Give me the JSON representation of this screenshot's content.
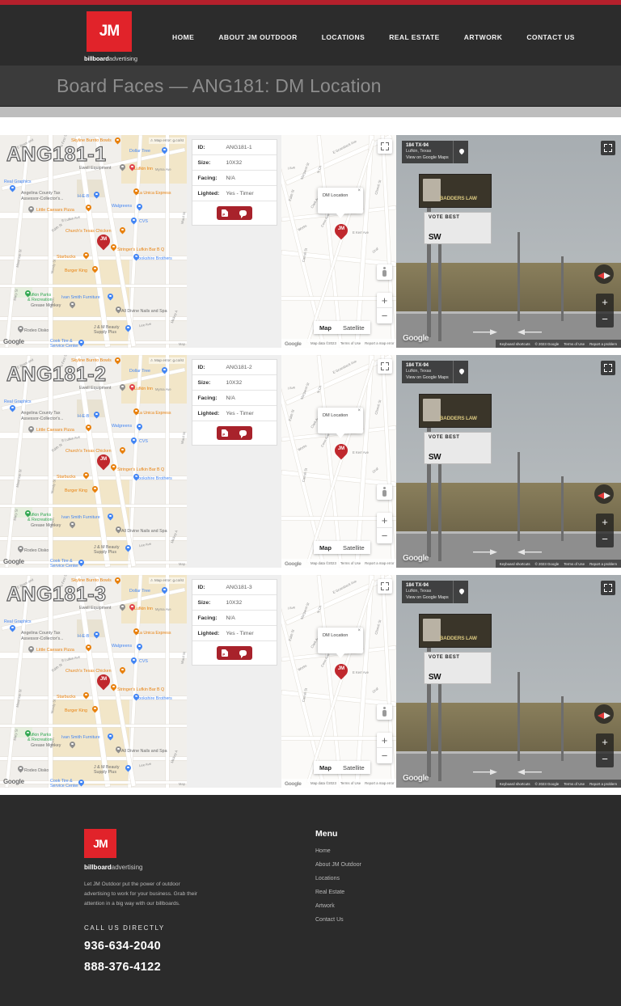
{
  "header": {
    "brand": {
      "mark": "JM",
      "tagline_bold": "billboard",
      "tagline_light": "advertising"
    },
    "nav": [
      {
        "label": "HOME"
      },
      {
        "label": "ABOUT JM OUTDOOR"
      },
      {
        "label": "LOCATIONS"
      },
      {
        "label": "REAL ESTATE"
      },
      {
        "label": "ARTWORK"
      },
      {
        "label": "CONTACT US"
      }
    ],
    "accent_color": "#b5202c",
    "background_color": "#2c2c2c"
  },
  "page_title": "Board Faces — ANG181: DM Location",
  "rows": [
    {
      "face_label": "ANG181-1",
      "static_map": {
        "map_error": "Map error: g.co/st",
        "attribution": "Google",
        "corner": "Map",
        "pois": [
          "Skyline Burrito Bowls",
          "Dollar Tree",
          "Ewell Equipment",
          "Lufkin Inn",
          "Real Graphics",
          "Angelina County Tax Assessor-Collector's...",
          "H-E-B",
          "La Unica Express",
          "Little Caesars Pizza",
          "Walgreens",
          "CVS",
          "Church's Texas Chicken",
          "Starbucks",
          "Stringer's Lufkin Bar B Q",
          "Brookshire Brothers",
          "Burger King",
          "Lufkin Parks & Recreation",
          "Ivan Smith Furniture",
          "Grease Monkey",
          "All Divine Nails and Spa",
          "Rodeo Disko",
          "J & M Beauty Supply Plus",
          "Cook Tire & Service Center"
        ],
        "streets": [
          "E Brem ond",
          "N First St",
          "Myrna Ave",
          "E Lufkin Ave",
          "Edith St",
          "Moody St",
          "Montrose St",
          "Lee Ave",
          "Mickey A",
          "Ward St"
        ]
      },
      "details": {
        "rows": [
          {
            "key": "ID:",
            "value": "ANG181-1"
          },
          {
            "key": "Size:",
            "value": "10X32"
          },
          {
            "key": "Facing:",
            "value": "N/A"
          },
          {
            "key": "Lighted:",
            "value": "Yes - Timer"
          }
        ],
        "buttons": [
          {
            "icon": "pdf-icon"
          },
          {
            "icon": "chat-icon"
          }
        ]
      },
      "interactive_map": {
        "infowindow_title": "DM Location",
        "close_label": "×",
        "map_type_options": [
          "Map",
          "Satellite"
        ],
        "map_type_selected": "Map",
        "zoom_in": "+",
        "zoom_out": "−",
        "attribution": "Google",
        "footer_links": [
          "Map data ©2023",
          "Terms of Use",
          "Report a map error"
        ],
        "streets": [
          "E Groesbeck Ave",
          "Margaret St",
          "N Ch",
          "Edith St",
          "Clark Ave",
          "Conn Ave",
          "Church St",
          "Carroll St",
          "E Kerr Ave",
          "Gra"
        ]
      },
      "street_view": {
        "address_line1": "184 TX-94",
        "address_line2": "Lufkin, Texas",
        "link_text": "View on Google Maps",
        "attribution": "Google",
        "billboard_top_text": "BADDERS LAW",
        "billboard_bottom_text1": "VOTE BEST",
        "billboard_bottom_text2": "SW",
        "footer_links": [
          "Keyboard shortcuts",
          "© 2023 Google",
          "Terms of Use",
          "Report a problem"
        ],
        "zoom_in": "+",
        "zoom_out": "−"
      }
    },
    {
      "face_label": "ANG181-2",
      "static_map": {
        "map_error": "Map error: g.co/st",
        "attribution": "Google",
        "corner": "Map",
        "pois": [
          "Skyline Burrito Bowls",
          "Dollar Tree",
          "Ewell Equipment",
          "Lufkin Inn",
          "Real Graphics",
          "Angelina County Tax Assessor-Collector's...",
          "H-E-B",
          "La Unica Express",
          "Little Caesars Pizza",
          "Walgreens",
          "CVS",
          "Church's Texas Chicken",
          "Starbucks",
          "Stringer's Lufkin Bar B Q",
          "Brookshire Brothers",
          "Burger King",
          "Lufkin Parks & Recreation",
          "Ivan Smith Furniture",
          "Grease Monkey",
          "All Divine Nails and Spa",
          "Rodeo Disko",
          "J & M Beauty Supply Plus",
          "Cook Tire & Service Center"
        ],
        "streets": [
          "E Brem ond",
          "N First St",
          "Myrna Ave",
          "E Lufkin Ave",
          "Edith St",
          "Moody St",
          "Montrose St",
          "Lee Ave",
          "Mickey A",
          "Ward St"
        ]
      },
      "details": {
        "rows": [
          {
            "key": "ID:",
            "value": "ANG181-2"
          },
          {
            "key": "Size:",
            "value": "10X32"
          },
          {
            "key": "Facing:",
            "value": "N/A"
          },
          {
            "key": "Lighted:",
            "value": "Yes - Timer"
          }
        ],
        "buttons": [
          {
            "icon": "pdf-icon"
          },
          {
            "icon": "chat-icon"
          }
        ]
      },
      "interactive_map": {
        "infowindow_title": "DM Location",
        "close_label": "×",
        "map_type_options": [
          "Map",
          "Satellite"
        ],
        "map_type_selected": "Map",
        "zoom_in": "+",
        "zoom_out": "−",
        "attribution": "Google",
        "footer_links": [
          "Map data ©2023",
          "Terms of Use",
          "Report a map error"
        ],
        "streets": [
          "E Groesbeck Ave",
          "Margaret St",
          "N Ch",
          "Edith St",
          "Clark Ave",
          "Conn Ave",
          "Church St",
          "Carroll St",
          "E Kerr Ave",
          "Gra"
        ]
      },
      "street_view": {
        "address_line1": "184 TX-94",
        "address_line2": "Lufkin, Texas",
        "link_text": "View on Google Maps",
        "attribution": "Google",
        "billboard_top_text": "BADDERS LAW",
        "billboard_bottom_text1": "VOTE BEST",
        "billboard_bottom_text2": "SW",
        "footer_links": [
          "Keyboard shortcuts",
          "© 2023 Google",
          "Terms of Use",
          "Report a problem"
        ],
        "zoom_in": "+",
        "zoom_out": "−"
      }
    },
    {
      "face_label": "ANG181-3",
      "static_map": {
        "map_error": "Map error: g.co/st",
        "attribution": "Google",
        "corner": "Map",
        "pois": [
          "Skyline Burrito Bowls",
          "Dollar Tree",
          "Ewell Equipment",
          "Lufkin Inn",
          "Real Graphics",
          "Angelina County Tax Assessor-Collector's...",
          "H-E-B",
          "La Unica Express",
          "Little Caesars Pizza",
          "Walgreens",
          "CVS",
          "Church's Texas Chicken",
          "Starbucks",
          "Stringer's Lufkin Bar B Q",
          "Brookshire Brothers",
          "Burger King",
          "Lufkin Parks & Recreation",
          "Ivan Smith Furniture",
          "Grease Monkey",
          "All Divine Nails and Spa",
          "Rodeo Disko",
          "J & M Beauty Supply Plus",
          "Cook Tire & Service Center"
        ],
        "streets": [
          "E Brem ond",
          "N First St",
          "Myrna Ave",
          "E Lufkin Ave",
          "Edith St",
          "Moody St",
          "Montrose St",
          "Lee Ave",
          "Mickey A",
          "Ward St"
        ]
      },
      "details": {
        "rows": [
          {
            "key": "ID:",
            "value": "ANG181-3"
          },
          {
            "key": "Size:",
            "value": "10X32"
          },
          {
            "key": "Facing:",
            "value": "N/A"
          },
          {
            "key": "Lighted:",
            "value": "Yes - Timer"
          }
        ],
        "buttons": [
          {
            "icon": "pdf-icon"
          },
          {
            "icon": "chat-icon"
          }
        ]
      },
      "interactive_map": {
        "infowindow_title": "DM Location",
        "close_label": "×",
        "map_type_options": [
          "Map",
          "Satellite"
        ],
        "map_type_selected": "Map",
        "zoom_in": "+",
        "zoom_out": "−",
        "attribution": "Google",
        "footer_links": [
          "Map data ©2023",
          "Terms of Use",
          "Report a map error"
        ],
        "streets": [
          "E Groesbeck Ave",
          "Margaret St",
          "N Ch",
          "Edith St",
          "Clark Ave",
          "Conn Ave",
          "Church St",
          "Carroll St",
          "E Kerr Ave",
          "Gra"
        ]
      },
      "street_view": {
        "address_line1": "184 TX-94",
        "address_line2": "Lufkin, Texas",
        "link_text": "View on Google Maps",
        "attribution": "Google",
        "billboard_top_text": "BADDERS LAW",
        "billboard_bottom_text1": "VOTE BEST",
        "billboard_bottom_text2": "SW",
        "footer_links": [
          "Keyboard shortcuts",
          "© 2023 Google",
          "Terms of Use",
          "Report a problem"
        ],
        "zoom_in": "+",
        "zoom_out": "−"
      }
    }
  ],
  "footer": {
    "brand": {
      "mark": "JM",
      "tagline_bold": "billboard",
      "tagline_light": "advertising"
    },
    "description": "Let JM Outdoor put the power of outdoor advertising to work for your business. Grab their attention in a big way with our billboards.",
    "call_label": "CALL US DIRECTLY",
    "phone1": "936-634-2040",
    "phone2": "888-376-4122",
    "menu_title": "Menu",
    "menu": [
      {
        "label": "Home"
      },
      {
        "label": "About JM Outdoor"
      },
      {
        "label": "Locations"
      },
      {
        "label": "Real Estate"
      },
      {
        "label": "Artwork"
      },
      {
        "label": "Contact Us"
      }
    ]
  }
}
